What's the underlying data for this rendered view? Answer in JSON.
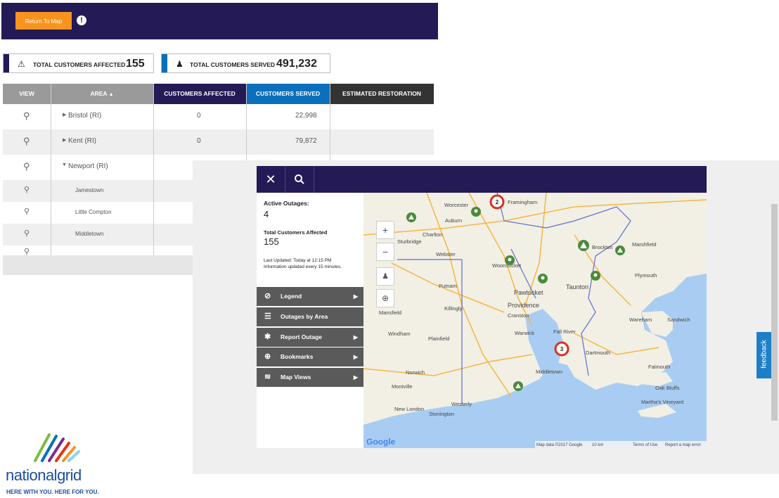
{
  "header": {
    "return_label": "Return To Map",
    "alert_icon": "!"
  },
  "stats": {
    "affected_label": "TOTAL CUSTOMERS AFFECTED",
    "affected_value": "155",
    "served_label": "TOTAL CUSTOMERS SERVED",
    "served_value": "491,232"
  },
  "table": {
    "columns": [
      "VIEW",
      "AREA",
      "CUSTOMERS AFFECTED",
      "CUSTOMERS SERVED",
      "ESTIMATED RESTORATION"
    ],
    "rows": [
      {
        "area": "Bristol (RI)",
        "affected": "0",
        "served": "22,998",
        "restoration": ""
      },
      {
        "area": "Kent (RI)",
        "affected": "0",
        "served": "79,872",
        "restoration": ""
      },
      {
        "area": "Newport (RI)",
        "affected": "",
        "served": "",
        "restoration": ""
      }
    ],
    "subrows": [
      "Jamestown",
      "Little Compton",
      "Middletown"
    ]
  },
  "map_panel": {
    "active_label": "Active Outages:",
    "active_value": "4",
    "affected_label": "Total Customers Affected",
    "affected_value": "155",
    "last_updated": "Last Updated: Today at 12:15 PM",
    "update_freq": "Information updated every 15 minutes.",
    "menu": [
      "Legend",
      "Outages by Area",
      "Report Outage",
      "Bookmarks",
      "Map Views"
    ],
    "feedback": "feedback"
  },
  "map": {
    "places": [
      "Worcester",
      "Framingham",
      "Auburn",
      "Charlton",
      "Sturbridge",
      "Webster",
      "Woonsocket",
      "Putnam",
      "Killingly",
      "Mansfield",
      "Pawtucket",
      "Providence",
      "Cranston",
      "Warwick",
      "Taunton",
      "Fall River",
      "Dartmouth",
      "Westerly",
      "Stonington",
      "New London",
      "Norwich",
      "Montville",
      "Plainfield",
      "Windham",
      "Marshfield",
      "Plymouth",
      "Wareham",
      "Sandwich",
      "Falmouth",
      "Oak Bluffs",
      "Martha's Vineyard",
      "Middletown",
      "Brockton"
    ],
    "cluster_2": "2",
    "cluster_3": "3",
    "google": "Google",
    "attribution": "Map data ©2017 Google",
    "scale": "10 km",
    "terms": "Terms of Use",
    "report": "Report a map error"
  },
  "logo": {
    "brand": "nationalgrid",
    "tagline": "HERE WITH YOU. HERE FOR YOU."
  },
  "colors": {
    "navy": "#231a56",
    "orange": "#f7941e",
    "blue": "#0b6fbb",
    "dark": "#333333",
    "green": "#4a8a3a"
  }
}
